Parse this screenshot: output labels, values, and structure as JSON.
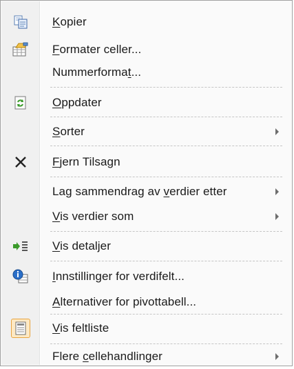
{
  "menu": {
    "items": [
      {
        "pre": "",
        "ul": "K",
        "post": "opier",
        "icon": "copy-icon"
      },
      {
        "pre": "",
        "ul": "F",
        "post": "ormater celler...",
        "icon": "format-cells-icon"
      },
      {
        "pre": "Nummerforma",
        "ul": "t",
        "post": "...",
        "icon": ""
      },
      {
        "pre": "",
        "ul": "O",
        "post": "ppdater",
        "icon": "refresh-icon"
      },
      {
        "pre": "",
        "ul": "S",
        "post": "orter",
        "icon": "",
        "submenu": true
      },
      {
        "pre": "",
        "ul": "F",
        "post": "jern  Tilsagn",
        "icon": "remove-x-icon"
      },
      {
        "pre": "Lag sammendrag av ",
        "ul": "v",
        "post": "erdier etter",
        "icon": "",
        "submenu": true
      },
      {
        "pre": "",
        "ul": "V",
        "post": "is verdier som",
        "icon": "",
        "submenu": true
      },
      {
        "pre": "",
        "ul": "V",
        "post": "is detaljer",
        "icon": "show-details-icon"
      },
      {
        "pre": "",
        "ul": "I",
        "post": "nnstillinger for verdifelt...",
        "icon": "field-settings-icon"
      },
      {
        "pre": "",
        "ul": "A",
        "post": "lternativer for pivottabell...",
        "icon": ""
      },
      {
        "pre": "",
        "ul": "V",
        "post": "is feltliste",
        "icon": "field-list-icon"
      },
      {
        "pre": "Flere ",
        "ul": "c",
        "post": "ellehandlinger",
        "icon": "",
        "submenu": true
      }
    ]
  },
  "colors": {
    "menu_background": "#fafafa",
    "gutter": "#f0f0f0",
    "separator": "#c5c5c5",
    "text": "#1a1a1a",
    "highlight_icon_border": "#e8a33d"
  }
}
